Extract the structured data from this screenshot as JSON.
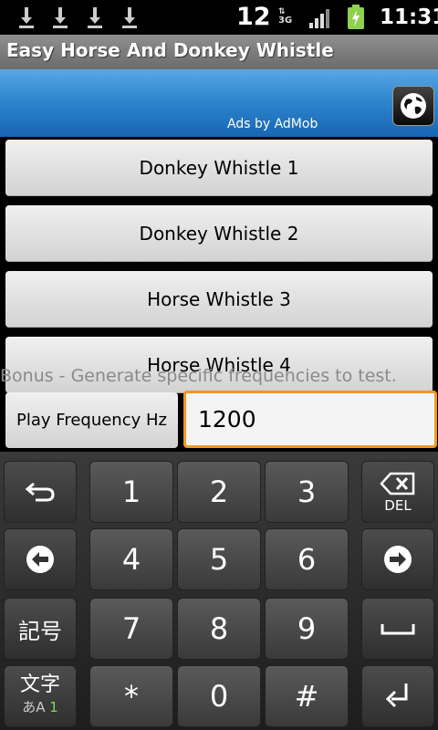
{
  "status_bar": {
    "notification_count": "12",
    "network": "3G",
    "time": "11:31"
  },
  "app": {
    "title": "Easy Horse And Donkey Whistle"
  },
  "ad": {
    "label": "Ads by AdMob"
  },
  "buttons": [
    {
      "label": "Donkey Whistle 1"
    },
    {
      "label": "Donkey Whistle 2"
    },
    {
      "label": "Horse Whistle 3"
    },
    {
      "label": "Horse Whistle 4"
    }
  ],
  "bonus_text": "Bonus - Generate specific frequencies to test.",
  "frequency": {
    "play_label": "Play Frequency Hz",
    "value": "1200"
  },
  "keyboard": {
    "digits": [
      "1",
      "2",
      "3",
      "4",
      "5",
      "6",
      "7",
      "8",
      "9",
      "*",
      "0",
      "#"
    ],
    "del_label": "DEL",
    "kigo_label": "記号",
    "moji_label": "文字",
    "mode_label": "あA",
    "mode_num": "1"
  }
}
